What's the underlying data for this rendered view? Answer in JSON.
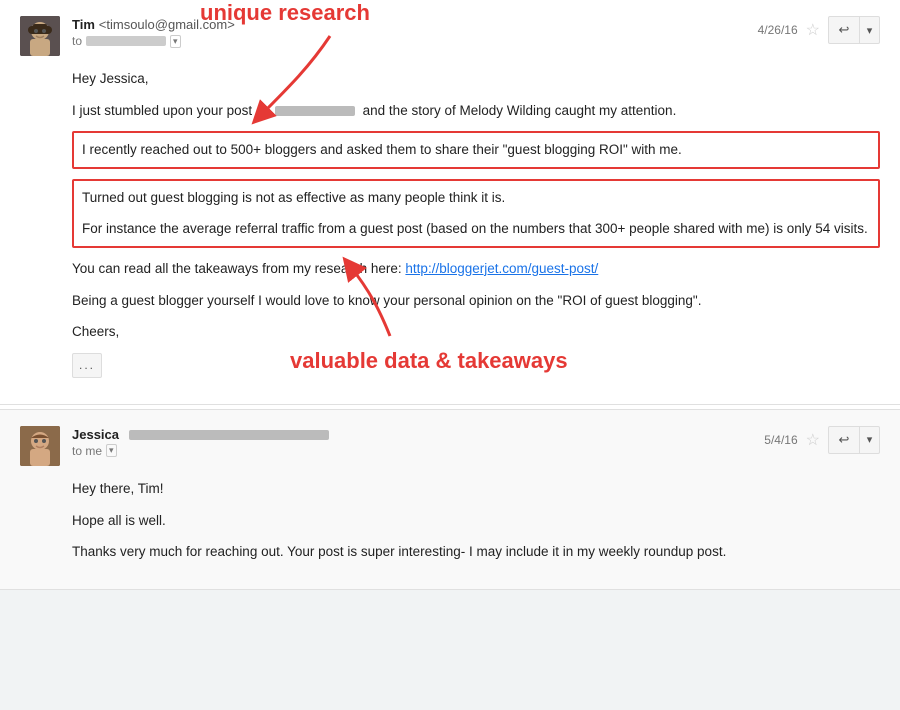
{
  "email1": {
    "sender_name": "Tim",
    "sender_email": "<timsoulo@gmail.com>",
    "to_label": "to",
    "to_redacted": true,
    "date": "4/26/16",
    "body": {
      "greeting": "Hey Jessica,",
      "line1": "I just stumbled upon your post at",
      "line1_middle_redacted": true,
      "line1_end": "and the story of Melody Wilding caught my attention.",
      "highlighted1": "I recently reached out to 500+ bloggers and asked them to share their \"guest blogging ROI\" with me.",
      "highlighted2_line1": "Turned out guest blogging is not as effective as many people think it is.",
      "highlighted2_line2": "For instance the average referral traffic from a guest post (based on the numbers that 300+ people shared with me) is only 54 visits.",
      "line_research_start": "You can read all the takeaways from my research here: ",
      "link": "http://bloggerjet.com/guest-post/",
      "line_opinion": "Being a guest blogger yourself I would love to know your personal opinion on the \"ROI of guest blogging\".",
      "closing": "Cheers,"
    },
    "more_btn": "..."
  },
  "annotation1": {
    "label": "unique research",
    "label_position": "top"
  },
  "annotation2": {
    "label": "valuable data & takeaways",
    "label_position": "bottom"
  },
  "email2": {
    "sender_name": "Jessica",
    "sender_email_redacted": true,
    "to_label": "to me",
    "date": "5/4/16",
    "body": {
      "greeting": "Hey there, Tim!",
      "line1": "Hope all is well.",
      "line2": "Thanks very much for reaching out. Your post is super interesting- I may include it in my weekly roundup post."
    }
  },
  "icons": {
    "star": "☆",
    "reply": "↩",
    "chevron_down": "▾"
  }
}
